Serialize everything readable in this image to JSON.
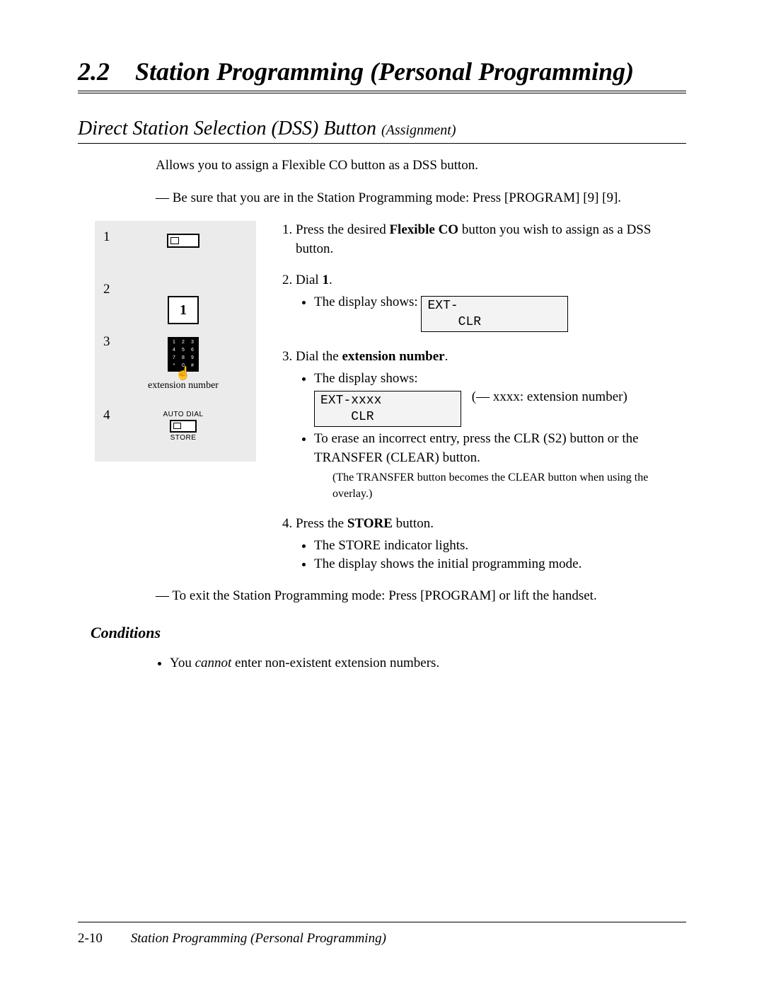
{
  "header": {
    "section_number": "2.2",
    "section_title": "Station Programming (Personal Programming)"
  },
  "subsection": {
    "title_main": "Direct Station Selection (DSS) Button",
    "title_small": "(Assignment)"
  },
  "intro_text": "Allows you to assign a Flexible CO button as a DSS button.",
  "precheck_text": "— Be sure that you are in the Station Programming mode: Press [PROGRAM] [9] [9].",
  "sidebar": {
    "steps": [
      "1",
      "2",
      "3",
      "4"
    ],
    "key1_label": "1",
    "keypad_keys": [
      "1",
      "2",
      "3",
      "4",
      "5",
      "6",
      "7",
      "8",
      "9",
      "*",
      "0",
      "#"
    ],
    "ext_label": "extension number",
    "autodial_label": "AUTO DIAL",
    "store_label": "STORE"
  },
  "steps": {
    "s1_a": "Press the desired ",
    "s1_bold": "Flexible CO",
    "s1_b": " button you wish to assign as a DSS button.",
    "s2_a": "Dial ",
    "s2_bold": "1",
    "s2_b": ".",
    "s2_bullet": "The display shows:",
    "s2_display": "EXT-\n    CLR",
    "s3_a": "Dial the ",
    "s3_bold": "extension number",
    "s3_b": ".",
    "s3_bullet": "The display shows:",
    "s3_display": "EXT-xxxx\n    CLR",
    "s3_note": "(— xxxx: extension number)",
    "s3_erase": "To erase an incorrect entry, press the CLR (S2) button or the TRANSFER (CLEAR) button.",
    "s3_overlay": "(The TRANSFER  button becomes the CLEAR button when using the overlay.)",
    "s4_a": "Press the ",
    "s4_bold": "STORE",
    "s4_b": " button.",
    "s4_bullet1": "The STORE indicator lights.",
    "s4_bullet2": "The display shows the initial programming mode."
  },
  "exit_text": "— To exit the Station Programming mode: Press [PROGRAM] or lift the handset.",
  "conditions": {
    "heading": "Conditions",
    "item1_a": "You ",
    "item1_italic": "cannot",
    "item1_b": " enter non-existent extension numbers."
  },
  "footer": {
    "page_number": "2-10",
    "title": "Station Programming (Personal Programming)"
  }
}
